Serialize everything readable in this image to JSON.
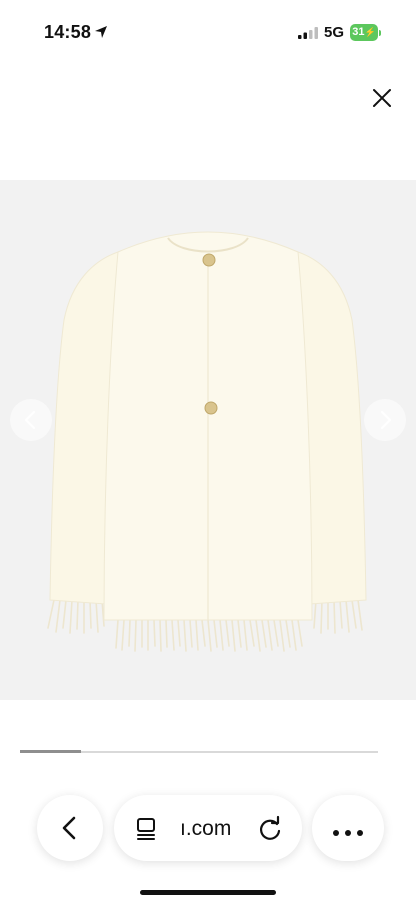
{
  "status_bar": {
    "time": "14:58",
    "location_icon": "location-arrow-icon",
    "signal_icon": "cellular-signal-icon",
    "network": "5G",
    "battery": "31"
  },
  "toolbar": {
    "close_icon": "close-icon"
  },
  "gallery": {
    "image_alt": "cream wool jacket with fringe",
    "prev_icon": "chevron-left-icon",
    "next_icon": "chevron-right-icon",
    "progress_fraction": 0.17
  },
  "browser": {
    "back_icon": "chevron-left-icon",
    "reader_icon": "reader-mode-icon",
    "url": "ı.com",
    "reload_icon": "reload-icon",
    "more_icon": "more-icon"
  },
  "colors": {
    "battery": "#5cc75d",
    "gallery_bg": "#f2f2f2",
    "jacket": "#fbf7e6"
  }
}
